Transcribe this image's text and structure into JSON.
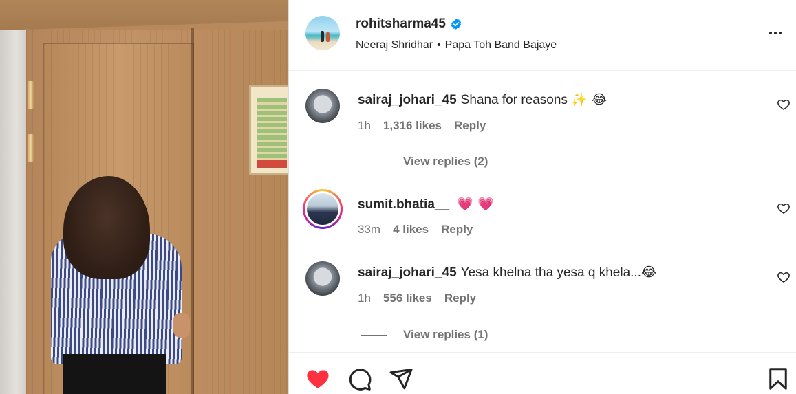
{
  "post": {
    "username": "rohitsharma45",
    "verified_icon": "verified-badge-icon",
    "audio": {
      "artist": "Neeraj Shridhar",
      "separator": "•",
      "track": "Papa Toh Band Bajaye"
    },
    "more_icon": "more-options-icon"
  },
  "comments": [
    {
      "username": "sairaj_johari_45",
      "text": "Shana for reasons",
      "emoji": "✨ 😂",
      "time": "1h",
      "likes": "1,316 likes",
      "reply_label": "Reply",
      "view_replies": "View replies (2)"
    },
    {
      "username": "sumit.bhatia__",
      "text": "",
      "emoji": "💗 💗",
      "time": "33m",
      "likes": "4 likes",
      "reply_label": "Reply",
      "view_replies": ""
    },
    {
      "username": "sairaj_johari_45",
      "text": "Yesa khelna tha yesa q khela...",
      "emoji": "😂",
      "time": "1h",
      "likes": "556 likes",
      "reply_label": "Reply",
      "view_replies": "View replies (1)"
    }
  ],
  "actions": {
    "like_icon": "heart-filled-icon",
    "comment_icon": "comment-icon",
    "share_icon": "share-icon",
    "save_icon": "bookmark-icon",
    "like_color": "#ff3040"
  },
  "colors": {
    "text_primary": "#262626",
    "text_secondary": "#737373",
    "verified": "#0095f6"
  }
}
